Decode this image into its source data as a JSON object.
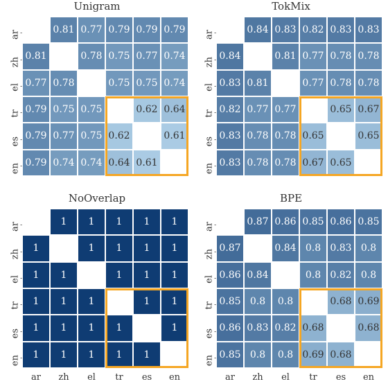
{
  "labels": [
    "ar",
    "zh",
    "el",
    "tr",
    "es",
    "en"
  ],
  "charts": [
    {
      "title": "Unigram",
      "show_xticks": false,
      "data": [
        [
          null,
          0.81,
          0.77,
          0.79,
          0.79,
          0.79
        ],
        [
          0.81,
          null,
          0.78,
          0.75,
          0.77,
          0.74
        ],
        [
          0.77,
          0.78,
          null,
          0.75,
          0.75,
          0.74
        ],
        [
          0.79,
          0.75,
          0.75,
          null,
          0.62,
          0.64
        ],
        [
          0.79,
          0.77,
          0.75,
          0.62,
          null,
          0.61
        ],
        [
          0.79,
          0.74,
          0.74,
          0.64,
          0.61,
          null
        ]
      ]
    },
    {
      "title": "TokMix",
      "show_xticks": false,
      "data": [
        [
          null,
          0.84,
          0.83,
          0.82,
          0.83,
          0.83
        ],
        [
          0.84,
          null,
          0.81,
          0.77,
          0.78,
          0.78
        ],
        [
          0.83,
          0.81,
          null,
          0.77,
          0.78,
          0.78
        ],
        [
          0.82,
          0.77,
          0.77,
          null,
          0.65,
          0.67
        ],
        [
          0.83,
          0.78,
          0.78,
          0.65,
          null,
          0.65
        ],
        [
          0.83,
          0.78,
          0.78,
          0.67,
          0.65,
          null
        ]
      ]
    },
    {
      "title": "NoOverlap",
      "show_xticks": true,
      "data": [
        [
          null,
          1,
          1,
          1,
          1,
          1
        ],
        [
          1,
          null,
          1,
          1,
          1,
          1
        ],
        [
          1,
          1,
          null,
          1,
          1,
          1
        ],
        [
          1,
          1,
          1,
          null,
          1,
          1
        ],
        [
          1,
          1,
          1,
          1,
          null,
          1
        ],
        [
          1,
          1,
          1,
          1,
          1,
          null
        ]
      ]
    },
    {
      "title": "BPE",
      "show_xticks": true,
      "data": [
        [
          null,
          0.87,
          0.86,
          0.85,
          0.86,
          0.85
        ],
        [
          0.87,
          null,
          0.84,
          0.8,
          0.83,
          0.8
        ],
        [
          0.86,
          0.84,
          null,
          0.8,
          0.82,
          0.8
        ],
        [
          0.85,
          0.8,
          0.8,
          null,
          0.68,
          0.69
        ],
        [
          0.86,
          0.83,
          0.82,
          0.68,
          null,
          0.68
        ],
        [
          0.85,
          0.8,
          0.8,
          0.69,
          0.68,
          null
        ]
      ]
    }
  ],
  "highlight": {
    "row_start": 3,
    "row_end": 6,
    "col_start": 3,
    "col_end": 6
  },
  "colorscale": {
    "min": 0.6,
    "max": 1.0
  },
  "chart_data": [
    {
      "type": "heatmap",
      "title": "Unigram",
      "x_labels": [
        "ar",
        "zh",
        "el",
        "tr",
        "es",
        "en"
      ],
      "y_labels": [
        "ar",
        "zh",
        "el",
        "tr",
        "es",
        "en"
      ],
      "values": [
        [
          null,
          0.81,
          0.77,
          0.79,
          0.79,
          0.79
        ],
        [
          0.81,
          null,
          0.78,
          0.75,
          0.77,
          0.74
        ],
        [
          0.77,
          0.78,
          null,
          0.75,
          0.75,
          0.74
        ],
        [
          0.79,
          0.75,
          0.75,
          null,
          0.62,
          0.64
        ],
        [
          0.79,
          0.77,
          0.75,
          0.62,
          null,
          0.61
        ],
        [
          0.79,
          0.74,
          0.74,
          0.64,
          0.61,
          null
        ]
      ],
      "highlight_box": {
        "rows": [
          3,
          5
        ],
        "cols": [
          3,
          5
        ]
      }
    },
    {
      "type": "heatmap",
      "title": "TokMix",
      "x_labels": [
        "ar",
        "zh",
        "el",
        "tr",
        "es",
        "en"
      ],
      "y_labels": [
        "ar",
        "zh",
        "el",
        "tr",
        "es",
        "en"
      ],
      "values": [
        [
          null,
          0.84,
          0.83,
          0.82,
          0.83,
          0.83
        ],
        [
          0.84,
          null,
          0.81,
          0.77,
          0.78,
          0.78
        ],
        [
          0.83,
          0.81,
          null,
          0.77,
          0.78,
          0.78
        ],
        [
          0.82,
          0.77,
          0.77,
          null,
          0.65,
          0.67
        ],
        [
          0.83,
          0.78,
          0.78,
          0.65,
          null,
          0.65
        ],
        [
          0.83,
          0.78,
          0.78,
          0.67,
          0.65,
          null
        ]
      ],
      "highlight_box": {
        "rows": [
          3,
          5
        ],
        "cols": [
          3,
          5
        ]
      }
    },
    {
      "type": "heatmap",
      "title": "NoOverlap",
      "x_labels": [
        "ar",
        "zh",
        "el",
        "tr",
        "es",
        "en"
      ],
      "y_labels": [
        "ar",
        "zh",
        "el",
        "tr",
        "es",
        "en"
      ],
      "values": [
        [
          null,
          1,
          1,
          1,
          1,
          1
        ],
        [
          1,
          null,
          1,
          1,
          1,
          1
        ],
        [
          1,
          1,
          null,
          1,
          1,
          1
        ],
        [
          1,
          1,
          1,
          null,
          1,
          1
        ],
        [
          1,
          1,
          1,
          1,
          null,
          1
        ],
        [
          1,
          1,
          1,
          1,
          1,
          null
        ]
      ],
      "highlight_box": {
        "rows": [
          3,
          5
        ],
        "cols": [
          3,
          5
        ]
      }
    },
    {
      "type": "heatmap",
      "title": "BPE",
      "x_labels": [
        "ar",
        "zh",
        "el",
        "tr",
        "es",
        "en"
      ],
      "y_labels": [
        "ar",
        "zh",
        "el",
        "tr",
        "es",
        "en"
      ],
      "values": [
        [
          null,
          0.87,
          0.86,
          0.85,
          0.86,
          0.85
        ],
        [
          0.87,
          null,
          0.84,
          0.8,
          0.83,
          0.8
        ],
        [
          0.86,
          0.84,
          null,
          0.8,
          0.82,
          0.8
        ],
        [
          0.85,
          0.8,
          0.8,
          null,
          0.68,
          0.69
        ],
        [
          0.86,
          0.83,
          0.82,
          0.68,
          null,
          0.68
        ],
        [
          0.85,
          0.8,
          0.8,
          0.69,
          0.68,
          null
        ]
      ],
      "highlight_box": {
        "rows": [
          3,
          5
        ],
        "cols": [
          3,
          5
        ]
      }
    }
  ]
}
